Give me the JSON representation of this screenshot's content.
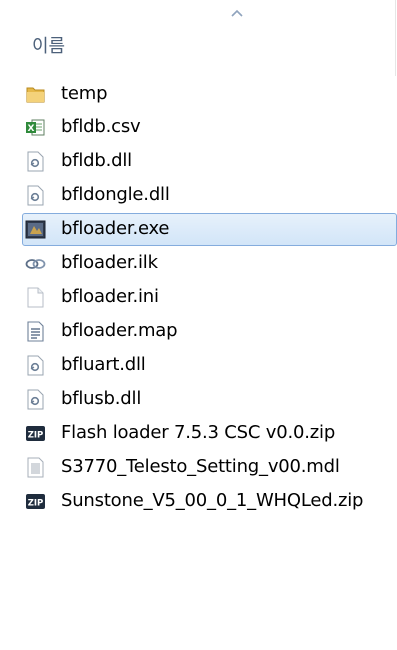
{
  "header": {
    "name_column": "이름",
    "sort_icon": "sort-ascending-icon"
  },
  "files": [
    {
      "name": "temp",
      "icon": "folder-icon"
    },
    {
      "name": "bfldb.csv",
      "icon": "excel-csv-icon"
    },
    {
      "name": "bfldb.dll",
      "icon": "dll-icon"
    },
    {
      "name": "bfldongle.dll",
      "icon": "dll-icon"
    },
    {
      "name": "bfloader.exe",
      "icon": "exe-icon",
      "selected": true
    },
    {
      "name": "bfloader.ilk",
      "icon": "ilk-icon"
    },
    {
      "name": "bfloader.ini",
      "icon": "ini-icon"
    },
    {
      "name": "bfloader.map",
      "icon": "text-file-icon"
    },
    {
      "name": "bfluart.dll",
      "icon": "dll-icon"
    },
    {
      "name": "bflusb.dll",
      "icon": "dll-icon"
    },
    {
      "name": "Flash loader 7.5.3 CSC v0.0.zip",
      "icon": "zip-icon"
    },
    {
      "name": "S3770_Telesto_Setting_v00.mdl",
      "icon": "mdl-file-icon"
    },
    {
      "name": "Sunstone_V5_00_0_1_WHQLed.zip",
      "icon": "zip-icon"
    }
  ]
}
